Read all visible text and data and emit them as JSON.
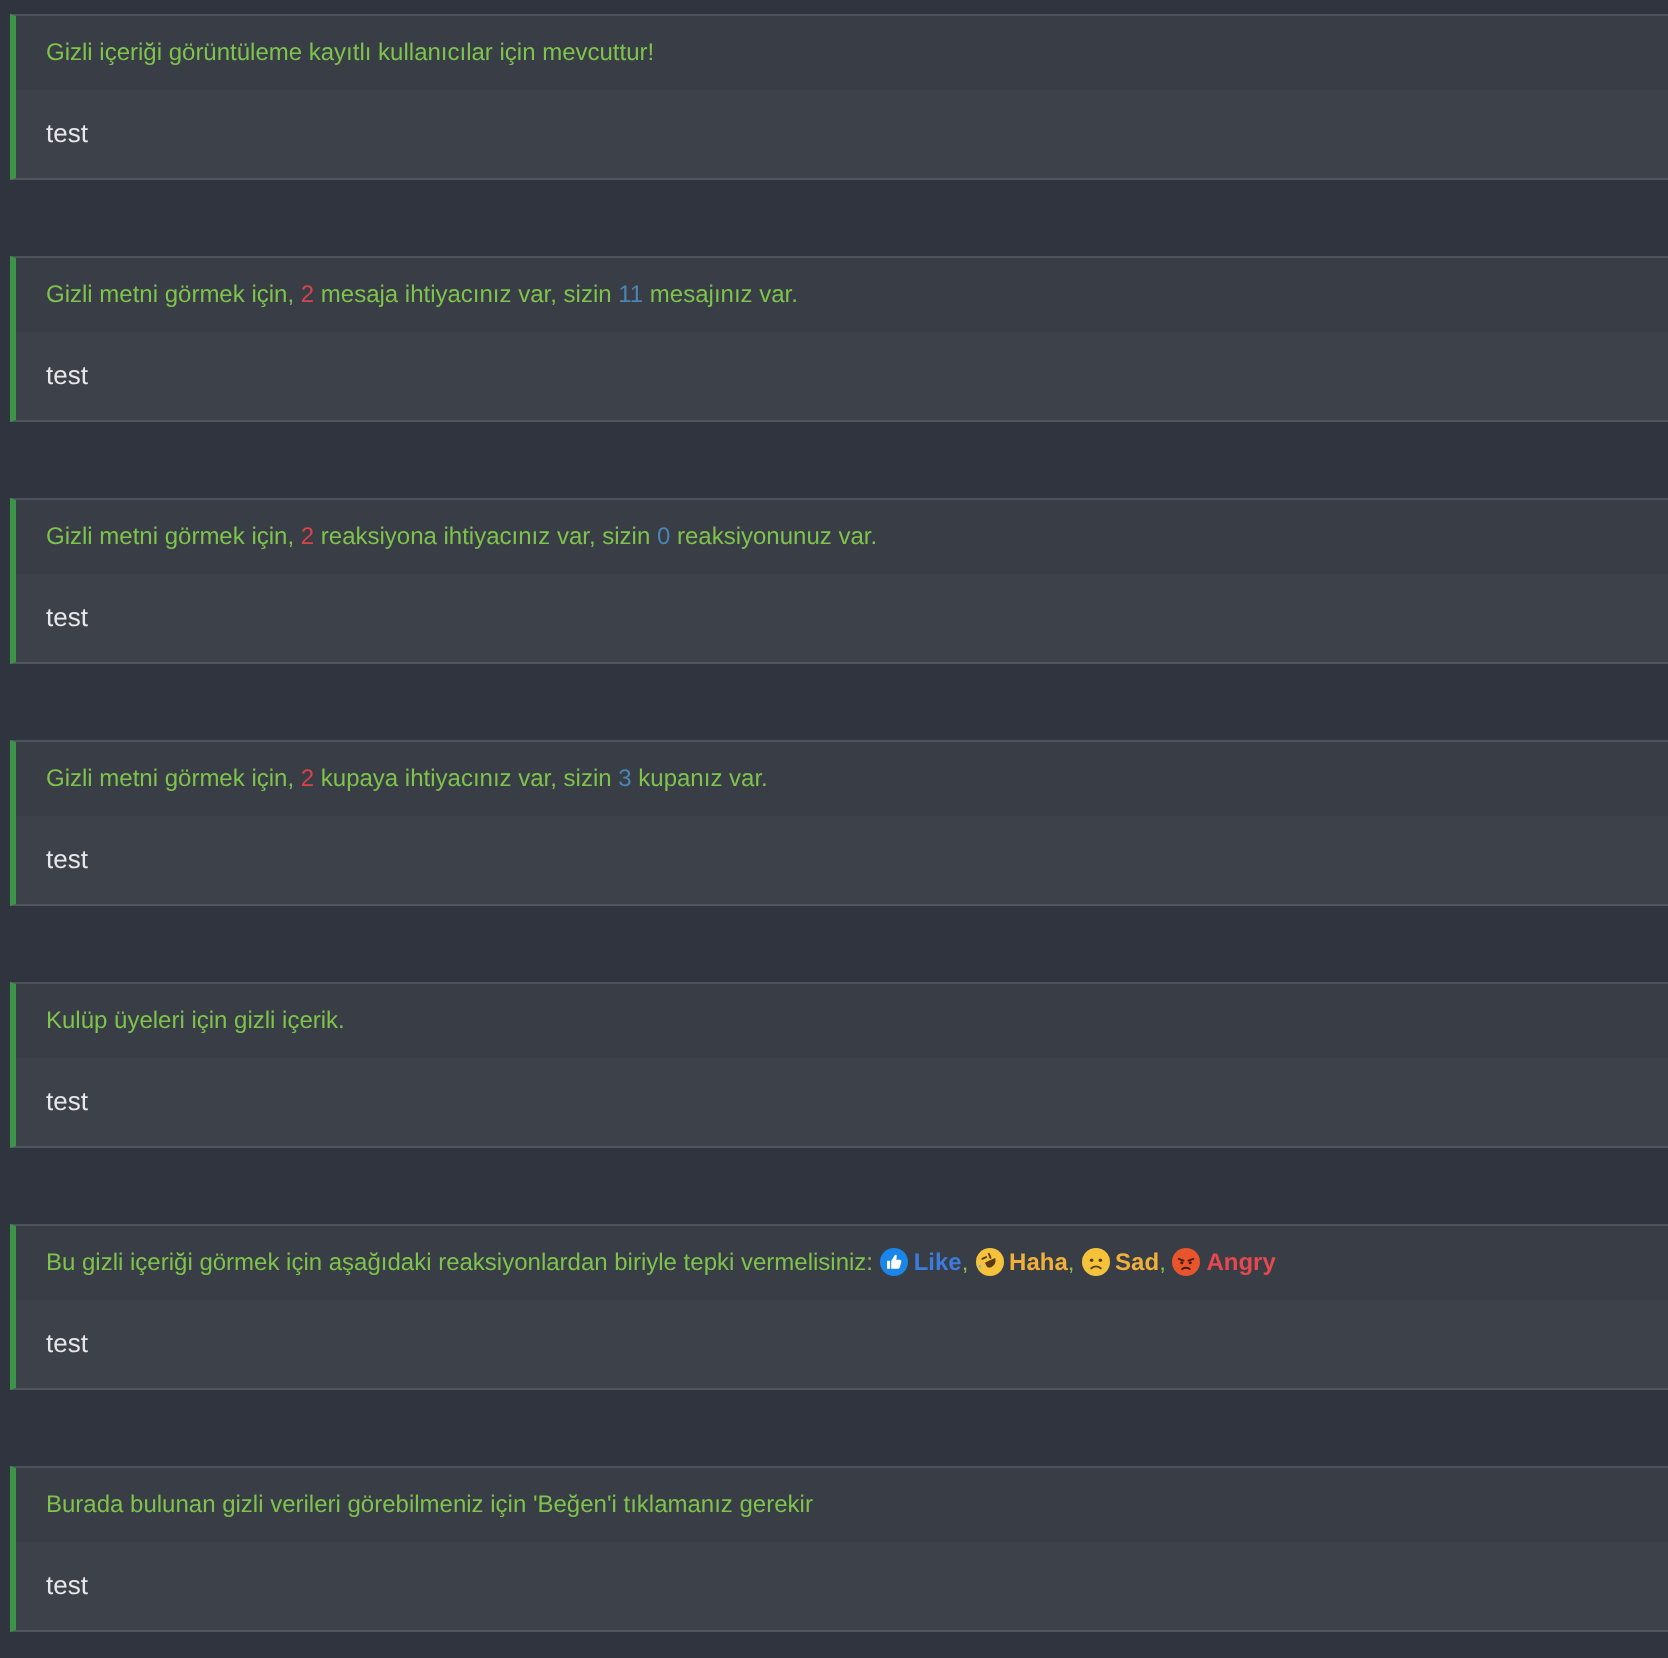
{
  "hidden_blocks": [
    {
      "notice": [
        {
          "kind": "text",
          "text": "Gizli içeriği görüntüleme kayıtlı kullanıcılar için mevcuttur!"
        }
      ],
      "content": "test"
    },
    {
      "notice": [
        {
          "kind": "text",
          "text": "Gizli metni görmek için, "
        },
        {
          "kind": "required",
          "text": "2"
        },
        {
          "kind": "text",
          "text": " mesaja ihtiyacınız var, sizin "
        },
        {
          "kind": "current",
          "text": "11"
        },
        {
          "kind": "text",
          "text": " mesajınız var."
        }
      ],
      "content": "test"
    },
    {
      "notice": [
        {
          "kind": "text",
          "text": "Gizli metni görmek için, "
        },
        {
          "kind": "required",
          "text": "2"
        },
        {
          "kind": "text",
          "text": " reaksiyona ihtiyacınız var, sizin "
        },
        {
          "kind": "current",
          "text": "0"
        },
        {
          "kind": "text",
          "text": " reaksiyonunuz var."
        }
      ],
      "content": "test"
    },
    {
      "notice": [
        {
          "kind": "text",
          "text": "Gizli metni görmek için, "
        },
        {
          "kind": "required",
          "text": "2"
        },
        {
          "kind": "text",
          "text": " kupaya ihtiyacınız var, sizin "
        },
        {
          "kind": "current",
          "text": "3"
        },
        {
          "kind": "text",
          "text": " kupanız var."
        }
      ],
      "content": "test"
    },
    {
      "notice": [
        {
          "kind": "text",
          "text": "Kulüp üyeleri için gizli içerik."
        }
      ],
      "content": "test"
    },
    {
      "notice": [
        {
          "kind": "text",
          "text": "Bu gizli içeriği görmek için aşağıdaki reaksiyonlardan biriyle tepki vermelisiniz: "
        },
        {
          "kind": "like",
          "label": "Like",
          "color": "#3b7ddd"
        },
        {
          "kind": "text",
          "text": ", "
        },
        {
          "kind": "haha",
          "label": "Haha",
          "color": "#f0b03a"
        },
        {
          "kind": "text",
          "text": ", "
        },
        {
          "kind": "sad",
          "label": "Sad",
          "color": "#f0b03a"
        },
        {
          "kind": "text",
          "text": ", "
        },
        {
          "kind": "angry",
          "label": "Angry",
          "color": "#e5484d"
        }
      ],
      "content": "test"
    },
    {
      "notice": [
        {
          "kind": "text",
          "text": "Burada bulunan gizli verileri görebilmeniz için 'Beğen'i tıklamanız gerekir"
        }
      ],
      "content": "test"
    }
  ]
}
